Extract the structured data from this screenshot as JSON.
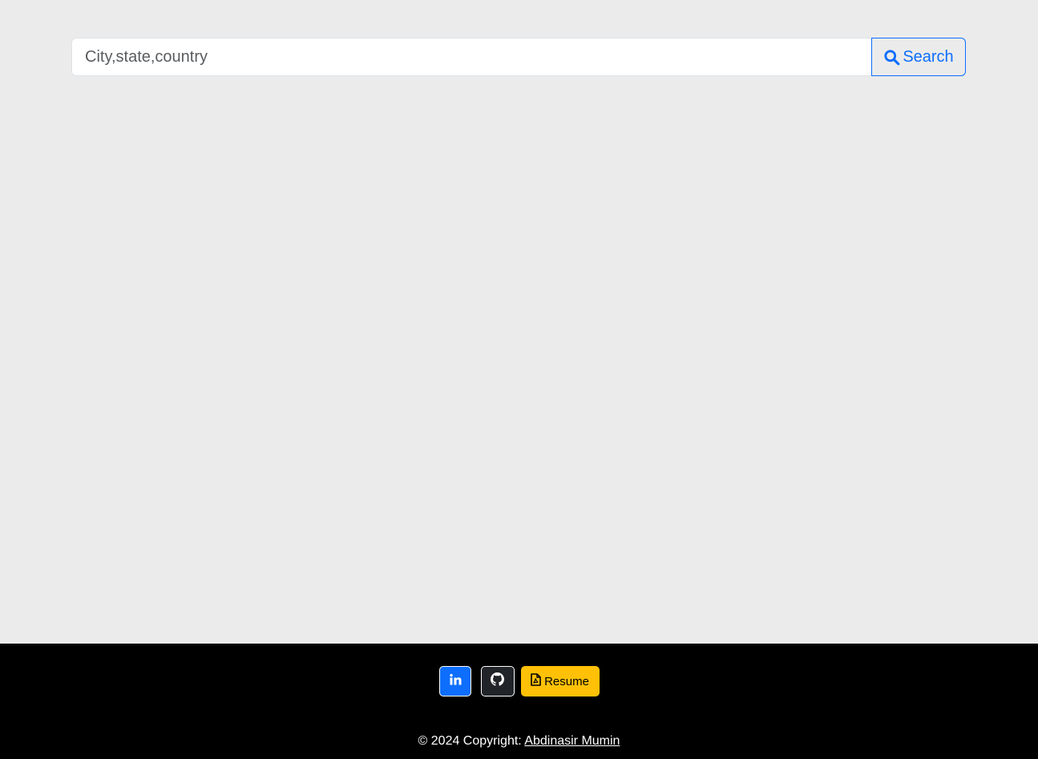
{
  "search": {
    "placeholder": "City,state,country",
    "value": "",
    "button_label": "Search",
    "icon": "search-icon"
  },
  "footer": {
    "social": [
      {
        "name": "linkedin",
        "icon": "linkedin-icon",
        "color": "#0d6efd"
      },
      {
        "name": "github",
        "icon": "github-icon",
        "color": "#212529"
      },
      {
        "name": "resume",
        "icon": "file-pdf-icon",
        "label": "Resume",
        "color": "#ffc107"
      }
    ],
    "copyright_prefix": "© 2024 Copyright:",
    "author_link": "Abdinasir Mumin"
  },
  "colors": {
    "background": "#ebebeb",
    "footer_background": "#000000",
    "accent": "#0d6efd"
  }
}
